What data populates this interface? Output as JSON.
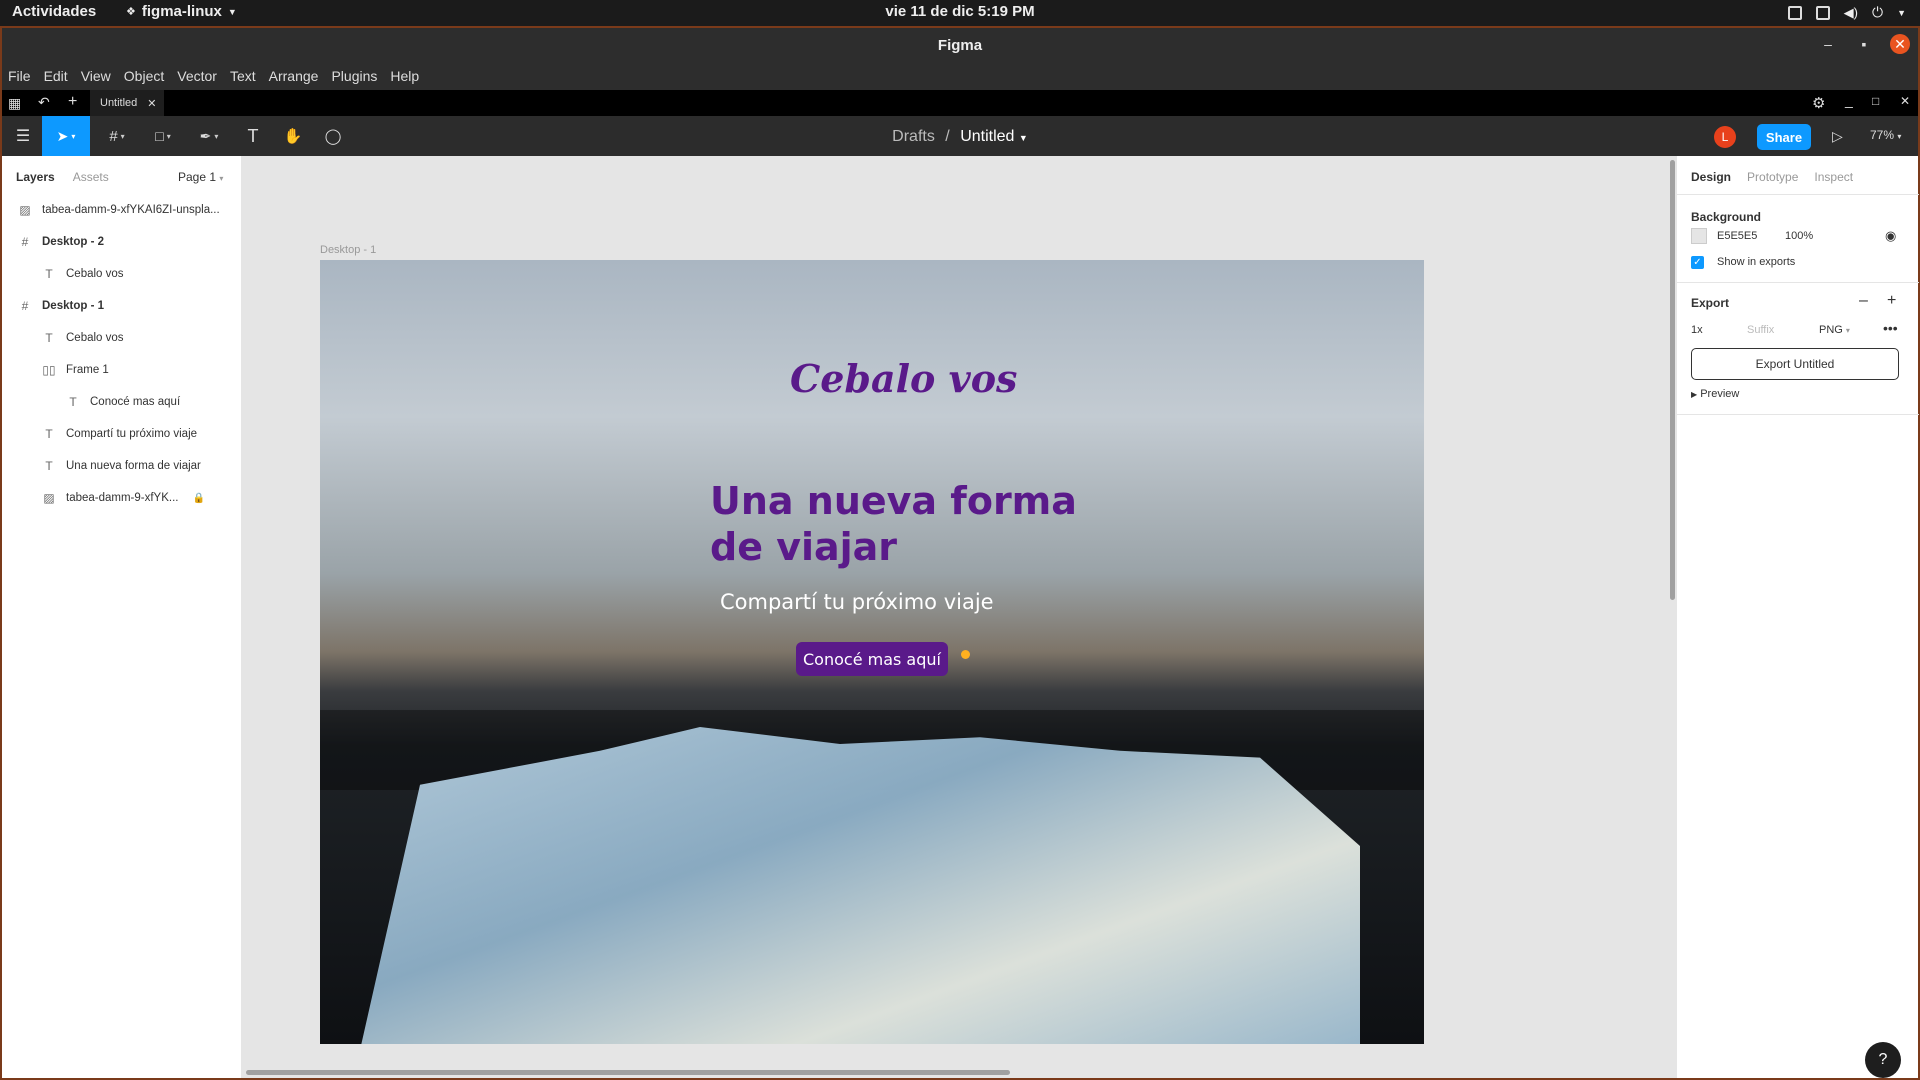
{
  "system_bar": {
    "activities": "Actividades",
    "app_name": "figma-linux",
    "clock": "vie 11 de dic   5:19 PM"
  },
  "window": {
    "title": "Figma"
  },
  "menu": {
    "items": [
      "File",
      "Edit",
      "View",
      "Object",
      "Vector",
      "Text",
      "Arrange",
      "Plugins",
      "Help"
    ]
  },
  "tabbar": {
    "tab_label": "Untitled"
  },
  "toolbar": {
    "breadcrumb_parent": "Drafts",
    "breadcrumb_sep": "/",
    "file_name": "Untitled",
    "avatar_initial": "L",
    "share_label": "Share",
    "zoom": "77%"
  },
  "left_panel": {
    "tab_layers": "Layers",
    "tab_assets": "Assets",
    "page": "Page 1",
    "layers": [
      {
        "label": "tabea-damm-9-xfYKAI6ZI-unspla...",
        "icon": "image-icon",
        "indent": 0,
        "bold": false
      },
      {
        "label": "Desktop - 2",
        "icon": "frame-icon",
        "indent": 0,
        "bold": true
      },
      {
        "label": "Cebalo vos",
        "icon": "text-icon",
        "indent": 1,
        "bold": false
      },
      {
        "label": "Desktop - 1",
        "icon": "frame-icon",
        "indent": 0,
        "bold": true
      },
      {
        "label": "Cebalo vos",
        "icon": "text-icon",
        "indent": 1,
        "bold": false
      },
      {
        "label": "Frame 1",
        "icon": "auto-layout-icon",
        "indent": 1,
        "bold": false
      },
      {
        "label": "Conocé mas aquí",
        "icon": "text-icon",
        "indent": 2,
        "bold": false
      },
      {
        "label": "Compartí tu próximo viaje",
        "icon": "text-icon",
        "indent": 1,
        "bold": false
      },
      {
        "label": "Una nueva forma de viajar",
        "icon": "text-icon",
        "indent": 1,
        "bold": false
      },
      {
        "label": "tabea-damm-9-xfYK...",
        "icon": "image-icon",
        "indent": 1,
        "bold": false,
        "locked": true
      }
    ]
  },
  "canvas": {
    "frame_label": "Desktop - 1",
    "logo_text": "Cebalo vos",
    "hero_title": "Una nueva forma de viajar",
    "hero_subtitle": "Compartí tu próximo viaje",
    "hero_button": "Conocé mas aquí"
  },
  "right_panel": {
    "tab_design": "Design",
    "tab_prototype": "Prototype",
    "tab_inspect": "Inspect",
    "background_title": "Background",
    "bg_hex": "E5E5E5",
    "bg_opacity": "100%",
    "show_in_exports": "Show in exports",
    "export_title": "Export",
    "export_scale": "1x",
    "export_suffix_placeholder": "Suffix",
    "export_format": "PNG",
    "export_button": "Export Untitled",
    "preview_label": "Preview",
    "help_label": "?"
  },
  "colors": {
    "accent": "#0d99ff",
    "brand_purple": "#5a1a8a",
    "avatar": "#e8411c",
    "window_close": "#e95420"
  }
}
